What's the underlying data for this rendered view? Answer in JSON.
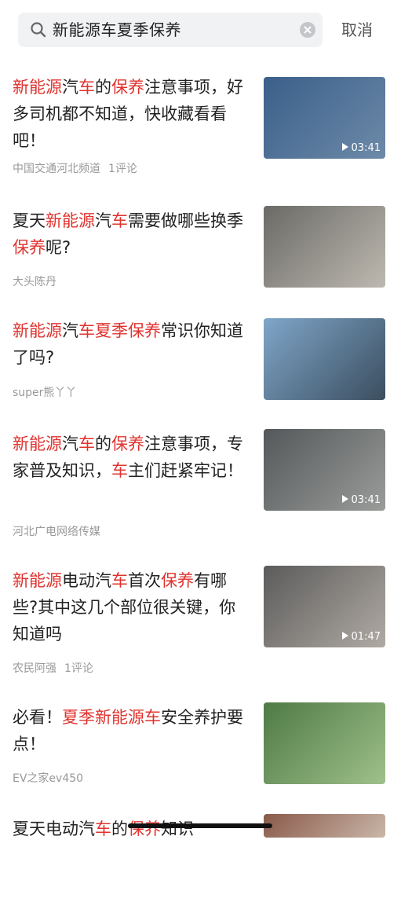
{
  "search": {
    "query": "新能源车夏季保养",
    "cancel_label": "取消"
  },
  "items": [
    {
      "title_parts": [
        {
          "t": "新能源",
          "h": true
        },
        {
          "t": "汽",
          "h": false
        },
        {
          "t": "车",
          "h": true
        },
        {
          "t": "的",
          "h": false
        },
        {
          "t": "保养",
          "h": true
        },
        {
          "t": "注意事项，好多司机都不知道，快收藏看看吧！",
          "h": false
        }
      ],
      "source": "中国交通河北频道",
      "comments": "1评论",
      "duration": "03:41",
      "thumb_colors": [
        "#3a5f8a",
        "#6d8aa8"
      ]
    },
    {
      "title_parts": [
        {
          "t": "夏天",
          "h": false
        },
        {
          "t": "新能源",
          "h": true
        },
        {
          "t": "汽",
          "h": false
        },
        {
          "t": "车",
          "h": true
        },
        {
          "t": "需要做哪些换季",
          "h": false
        },
        {
          "t": "保养",
          "h": true
        },
        {
          "t": "呢?",
          "h": false
        }
      ],
      "source": "大头陈丹",
      "comments": "",
      "duration": "",
      "thumb_colors": [
        "#6b6a66",
        "#bdb9b0"
      ]
    },
    {
      "title_parts": [
        {
          "t": "新能源",
          "h": true
        },
        {
          "t": "汽",
          "h": false
        },
        {
          "t": "车夏季保养",
          "h": true
        },
        {
          "t": "常识你知道了吗?",
          "h": false
        }
      ],
      "source": "super熊丫丫",
      "comments": "",
      "duration": "",
      "thumb_colors": [
        "#7fa6c9",
        "#3b4e5f"
      ]
    },
    {
      "title_parts": [
        {
          "t": "新能源",
          "h": true
        },
        {
          "t": "汽",
          "h": false
        },
        {
          "t": "车",
          "h": true
        },
        {
          "t": "的",
          "h": false
        },
        {
          "t": "保养",
          "h": true
        },
        {
          "t": "注意事项，专家普及知识，",
          "h": false
        },
        {
          "t": "车",
          "h": true
        },
        {
          "t": "主们赶紧牢记！",
          "h": false
        }
      ],
      "source": "河北广电网络传媒",
      "comments": "",
      "duration": "03:41",
      "thumb_colors": [
        "#55585a",
        "#9a9c9a"
      ]
    },
    {
      "title_parts": [
        {
          "t": "新能源",
          "h": true
        },
        {
          "t": "电动汽",
          "h": false
        },
        {
          "t": "车",
          "h": true
        },
        {
          "t": "首次",
          "h": false
        },
        {
          "t": "保养",
          "h": true
        },
        {
          "t": "有哪些?其中这几个部位很关键，你知道吗",
          "h": false
        }
      ],
      "source": "农民阿强",
      "comments": "1评论",
      "duration": "01:47",
      "thumb_colors": [
        "#5b5b5b",
        "#b0aaa3"
      ]
    },
    {
      "title_parts": [
        {
          "t": "必看！",
          "h": false
        },
        {
          "t": "夏季新能源车",
          "h": true
        },
        {
          "t": "安全养护要点！",
          "h": false
        }
      ],
      "source": "EV之家ev450",
      "comments": "",
      "duration": "",
      "thumb_colors": [
        "#4f7a45",
        "#9fc08a"
      ]
    },
    {
      "title_parts": [
        {
          "t": "夏天电动汽",
          "h": false
        },
        {
          "t": "车",
          "h": true
        },
        {
          "t": "的",
          "h": false
        },
        {
          "t": "保养",
          "h": true
        },
        {
          "t": "知识",
          "h": false
        }
      ],
      "source": "",
      "comments": "",
      "duration": "",
      "thumb_colors": [
        "#8a5a4a",
        "#c9b6a8"
      ]
    }
  ]
}
